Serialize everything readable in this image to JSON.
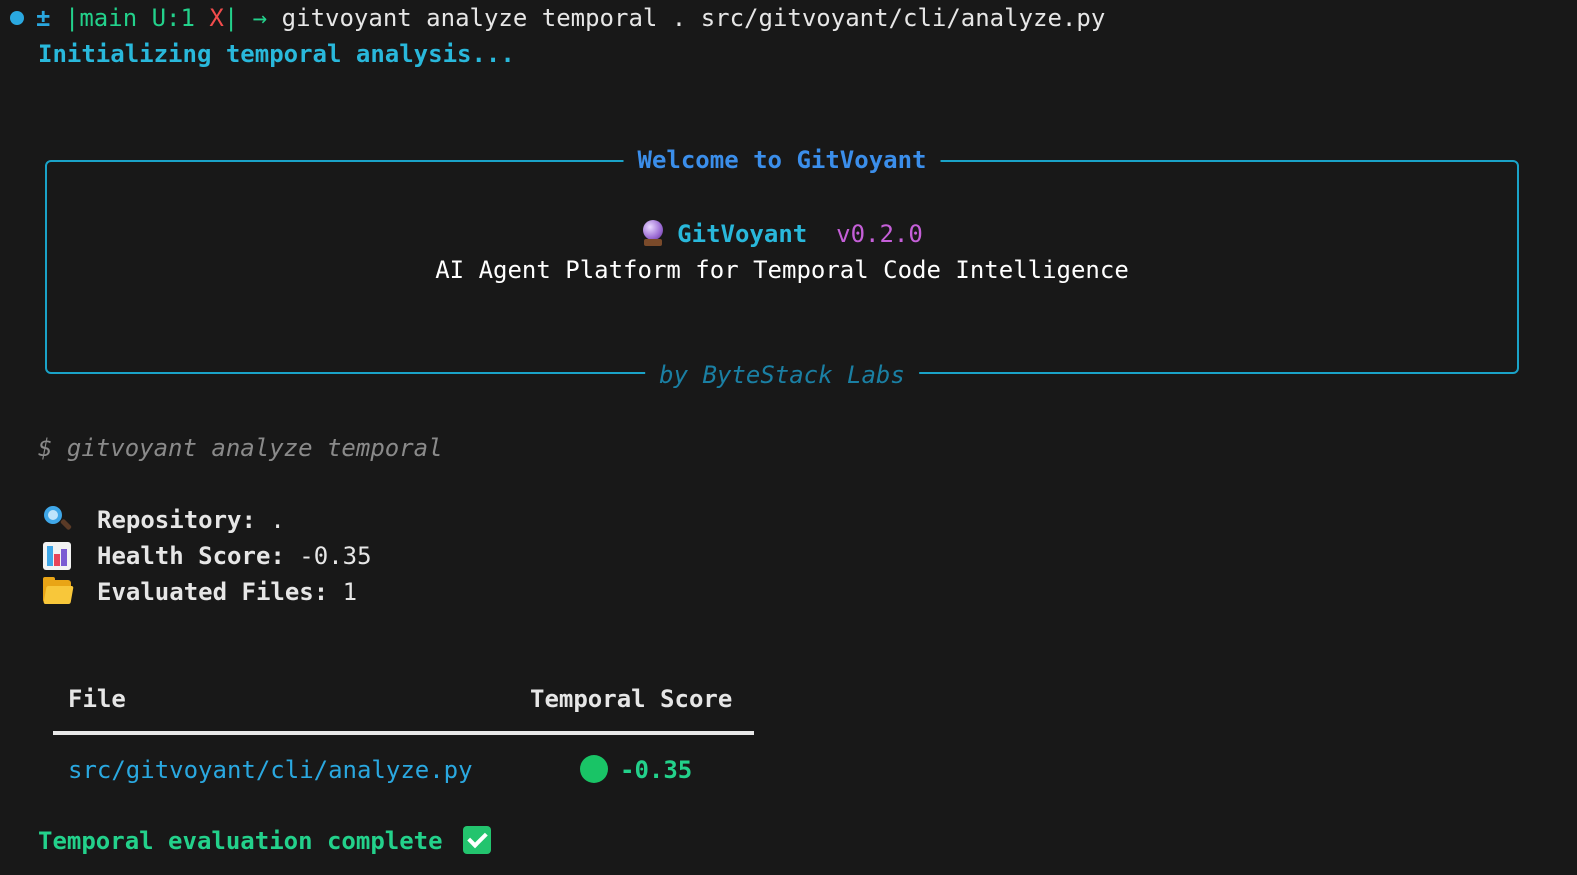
{
  "prompt": {
    "plus_minus": "±",
    "git_bar_open": "|",
    "branch": "main U:1",
    "dirty_mark": "X",
    "git_bar_close": "|",
    "arrow": "→",
    "command": "gitvoyant analyze temporal . src/gitvoyant/cli/analyze.py"
  },
  "status": {
    "initializing": "Initializing temporal analysis..."
  },
  "welcome_panel": {
    "title": "Welcome to GitVoyant",
    "icon": "crystal-ball-icon",
    "app_name": "GitVoyant",
    "version": "v0.2.0",
    "tagline": "AI Agent Platform for Temporal Code Intelligence",
    "subtitle": "by ByteStack Labs"
  },
  "command_echo": "$ gitvoyant analyze temporal",
  "summary": {
    "repository_label": "Repository:",
    "repository_value": ".",
    "health_label": "Health Score:",
    "health_value": "-0.35",
    "files_label": "Evaluated Files:",
    "files_value": "1"
  },
  "table": {
    "columns": [
      "File",
      "Temporal Score"
    ],
    "rows": [
      {
        "file": "src/gitvoyant/cli/analyze.py",
        "score": "-0.35",
        "status_color": "#19c466"
      }
    ]
  },
  "completion": {
    "text": "Temporal evaluation complete",
    "icon": "check-mark-icon"
  },
  "colors": {
    "background": "#181818",
    "accent_cyan": "#29b8db",
    "accent_blue": "#3b8eea",
    "success_green": "#23d18b",
    "version_magenta": "#c55fd8",
    "panel_border": "#1aa3c8"
  }
}
